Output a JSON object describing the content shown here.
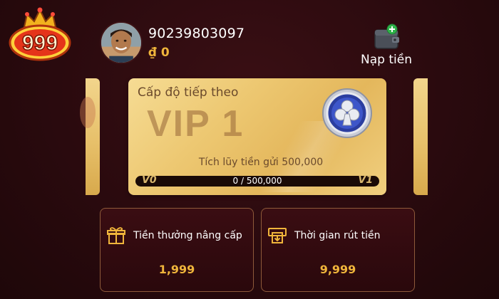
{
  "logo": {
    "text": "999",
    "icon": "crown-logo-icon"
  },
  "user": {
    "id": "90239803097",
    "currency_symbol": "₫",
    "balance": "0",
    "avatar_icon": "avatar-photo"
  },
  "topup": {
    "label": "Nạp tiền",
    "icon": "wallet-plus-icon"
  },
  "vip_card": {
    "next_level_label": "Cấp độ tiếp theo",
    "level": "VIP 1",
    "badge_icon": "club-badge-icon",
    "requirement": "Tích lũy tiền gửi 500,000",
    "progress": {
      "from_label": "V0",
      "to_label": "V1",
      "text": "0 / 500,000",
      "fraction": 0
    }
  },
  "info_cards": [
    {
      "icon": "gift-icon",
      "title": "Tiền thưởng nâng cấp",
      "value": "1,999"
    },
    {
      "icon": "withdraw-icon",
      "title": "Thời gian rút tiền",
      "value": "9,999"
    }
  ],
  "colors": {
    "background": "#2a0a0e",
    "gold": "#f0b53b",
    "card_gold": "#edc872",
    "card_border": "#8e5a3a"
  }
}
